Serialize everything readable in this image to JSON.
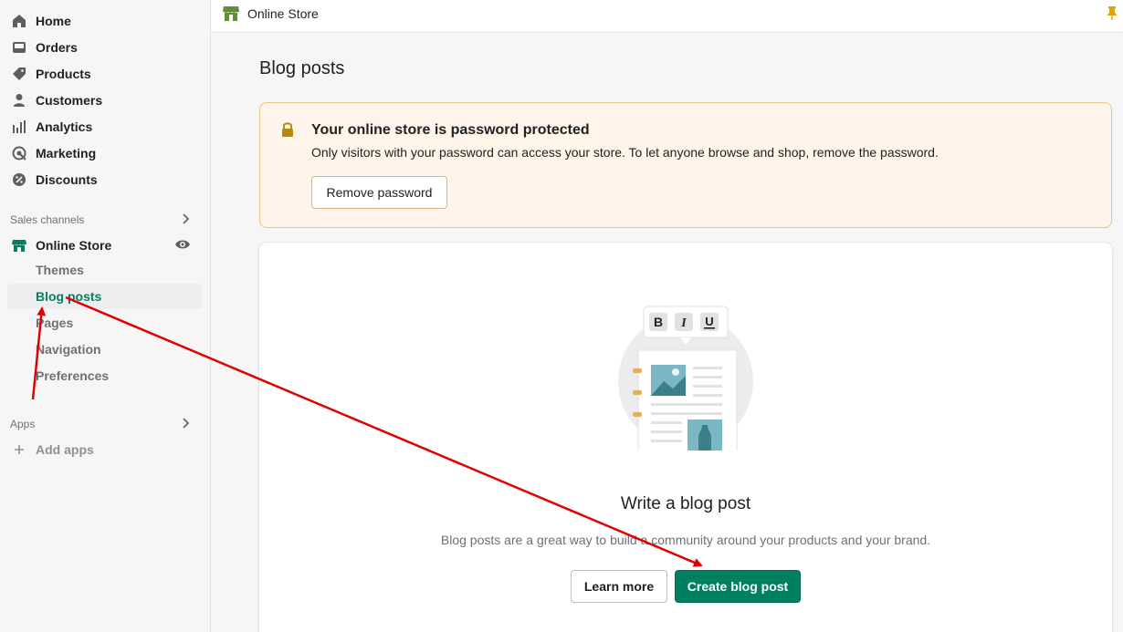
{
  "sidebar": {
    "items": [
      {
        "label": "Home",
        "icon": "home-icon"
      },
      {
        "label": "Orders",
        "icon": "orders-icon"
      },
      {
        "label": "Products",
        "icon": "tag-icon"
      },
      {
        "label": "Customers",
        "icon": "person-icon"
      },
      {
        "label": "Analytics",
        "icon": "bar-chart-icon"
      },
      {
        "label": "Marketing",
        "icon": "target-icon"
      },
      {
        "label": "Discounts",
        "icon": "discount-icon"
      }
    ],
    "sales_channels_title": "Sales channels",
    "online_store_label": "Online Store",
    "sub_items": [
      "Themes",
      "Blog posts",
      "Pages",
      "Navigation",
      "Preferences"
    ],
    "apps_title": "Apps",
    "add_apps_label": "Add apps"
  },
  "topbar": {
    "title": "Online Store"
  },
  "page": {
    "title": "Blog posts"
  },
  "banner": {
    "title": "Your online store is password protected",
    "text": "Only visitors with your password can access your store. To let anyone browse and shop, remove the password.",
    "button": "Remove password"
  },
  "empty_state": {
    "title": "Write a blog post",
    "text": "Blog posts are a great way to build a community around your products and your brand.",
    "secondary_button": "Learn more",
    "primary_button": "Create blog post"
  },
  "colors": {
    "accent": "#008060",
    "banner_bg": "#fff4e9",
    "annotation": "#e00000"
  }
}
